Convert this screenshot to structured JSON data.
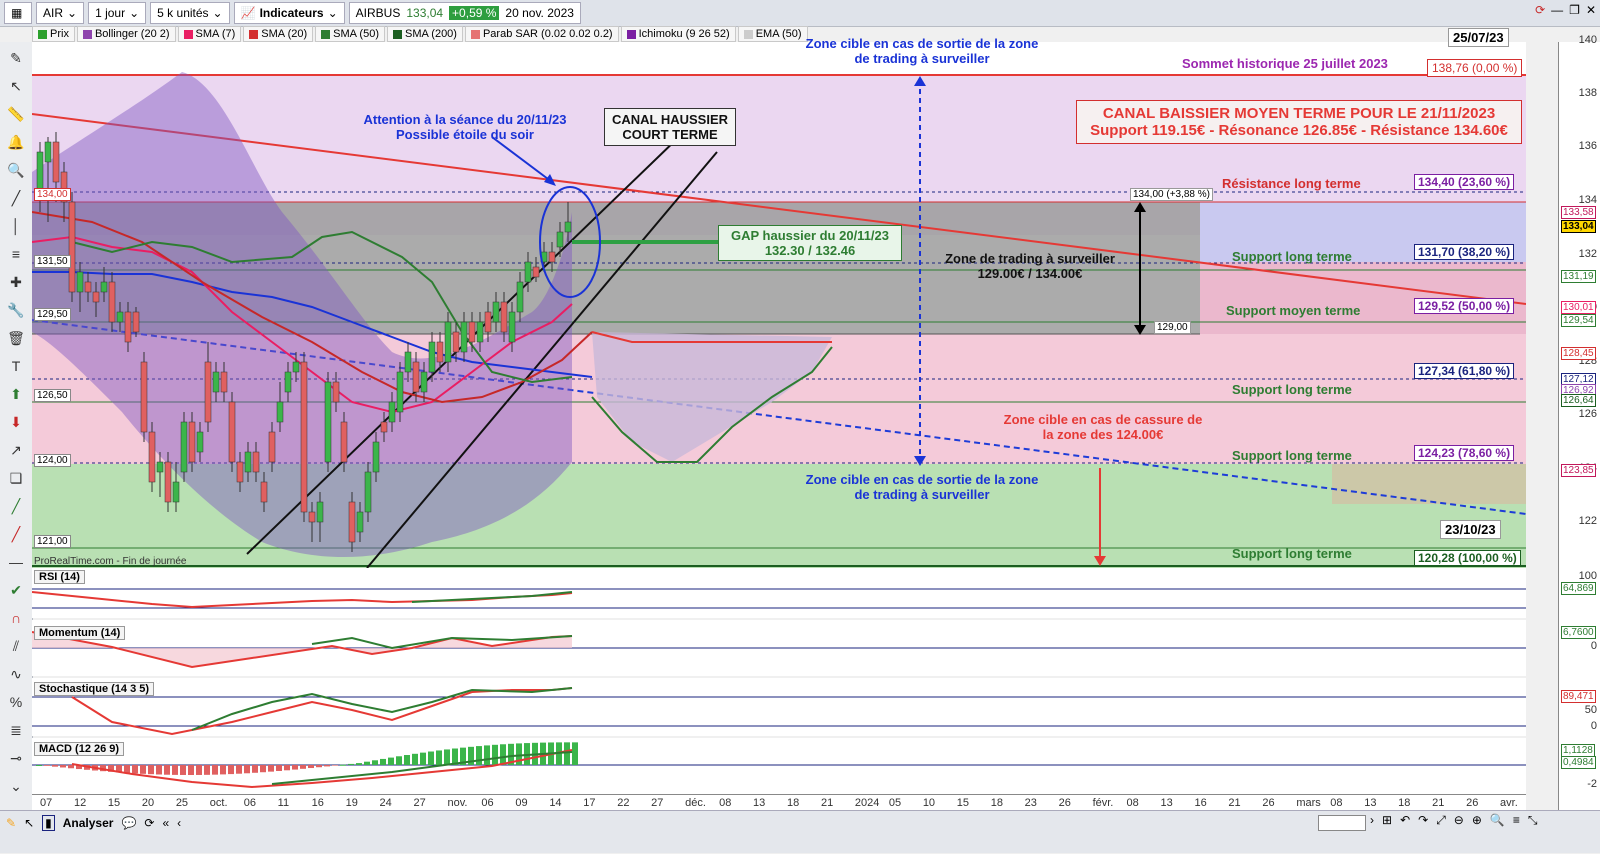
{
  "toolbar": {
    "symbol": "AIR",
    "period": "1 jour",
    "units": "5 k unités",
    "indicators": "Indicateurs",
    "instrument": "AIRBUS",
    "price": "133,04",
    "change": "+0,59 %",
    "date": "20 nov. 2023"
  },
  "legend": [
    {
      "label": "Prix",
      "color": "#2ca02c"
    },
    {
      "label": "Bollinger (20 2)",
      "color": "#8e44ad"
    },
    {
      "label": "SMA (7)",
      "color": "#e91e63"
    },
    {
      "label": "SMA (20)",
      "color": "#d32f2f"
    },
    {
      "label": "SMA (50)",
      "color": "#2e7d32"
    },
    {
      "label": "SMA (200)",
      "color": "#1b5e20"
    },
    {
      "label": "Parab SAR (0.02 0.02 0.2)",
      "color": "#e57373"
    },
    {
      "label": "Ichimoku (9 26 52)",
      "color": "#7b1fa2"
    },
    {
      "label": "EMA (50)",
      "color": "#cccccc"
    }
  ],
  "annotations": {
    "zone_top": "Zone cible en cas de sortie de la zone de trading à surveiller",
    "sommet": "Sommet historique 25 juillet 2023",
    "sommet_date": "25/07/23",
    "sommet_price": "138,76 (0,00 %)",
    "canal_baissier_title": "CANAL BAISSIER MOYEN TERME POUR LE 21/11/2023",
    "canal_baissier_levels": "Support 119.15€ - Résonance 126.85€ - Résistance 134.60€",
    "attention": "Attention à la séance du 20/11/23 Possible étoile du soir",
    "canal_haussier": "CANAL HAUSSIER COURT TERME",
    "gap": "GAP haussier du 20/11/23 132.30 / 132.46",
    "zone_trading": "Zone de trading à surveiller 129.00€ / 134.00€",
    "resistance_lt": "Résistance long terme",
    "support_lt_1": "Support long terme",
    "support_mt": "Support moyen terme",
    "support_lt_2": "Support long terme",
    "support_lt_3": "Support long terme",
    "support_lt_4": "Support long terme",
    "zone_cassure": "Zone cible en cas de cassure de la zone des 124.00€",
    "zone_bottom": "Zone cible en cas de sortie de la zone de trading à surveiller",
    "date_bottom": "23/10/23",
    "box_134": "134,00 (+3,88 %)",
    "box_129": "129,00",
    "footer": "ProRealTime.com - Fin de journée"
  },
  "fib_levels": [
    {
      "label": "134,40 (23,60 %)",
      "color": "#7b1fa2"
    },
    {
      "label": "131,70 (38,20 %)",
      "color": "#1a237e"
    },
    {
      "label": "129,52 (50,00 %)",
      "color": "#7b1fa2"
    },
    {
      "label": "127,34 (61,80 %)",
      "color": "#1a237e"
    },
    {
      "label": "124,23 (78,60 %)",
      "color": "#7b1fa2"
    },
    {
      "label": "120,28 (100,00 %)",
      "color": "#1b5e20"
    }
  ],
  "left_levels": [
    "134,00",
    "131,50",
    "129,50",
    "126,50",
    "124,00",
    "121,00"
  ],
  "right_axis": [
    "140",
    "138",
    "136",
    "134",
    "132",
    "130",
    "128",
    "126",
    "124",
    "122"
  ],
  "right_tags": [
    {
      "label": "133,58",
      "color": "#c2185b"
    },
    {
      "label": "133,04",
      "color": "#000000"
    },
    {
      "label": "131,19",
      "color": "#2e7d32"
    },
    {
      "label": "130,01",
      "color": "#e91e63"
    },
    {
      "label": "129,54",
      "color": "#2e7d32"
    },
    {
      "label": "128,45",
      "color": "#d32f2f"
    },
    {
      "label": "127,12",
      "color": "#1a237e"
    },
    {
      "label": "126,92",
      "color": "#8e44ad"
    },
    {
      "label": "126,64",
      "color": "#1b5e20"
    },
    {
      "label": "123,85",
      "color": "#c2185b"
    }
  ],
  "panels": [
    {
      "name": "RSI (14)",
      "value": "64,869",
      "scale_top": "100",
      "scale_bot": ""
    },
    {
      "name": "Momentum (14)",
      "value": "6,7600",
      "scale_top": "",
      "scale_bot": "0"
    },
    {
      "name": "Stochastique (14 3 5)",
      "value": "89,471",
      "scale_top": "50",
      "scale_bot": "0"
    },
    {
      "name": "MACD (12 26 9)",
      "value": "1,1128",
      "scale_top": "0,4984",
      "scale_bot": "-2"
    }
  ],
  "xaxis": [
    "07",
    "12",
    "15",
    "20",
    "25",
    "oct.",
    "06",
    "11",
    "16",
    "19",
    "24",
    "27",
    "nov.",
    "06",
    "09",
    "14",
    "17",
    "22",
    "27",
    "déc.",
    "08",
    "13",
    "18",
    "21",
    "2024",
    "05",
    "10",
    "15",
    "18",
    "23",
    "26",
    "févr.",
    "08",
    "13",
    "16",
    "21",
    "26",
    "mars",
    "08",
    "13",
    "18",
    "21",
    "26",
    "avr."
  ],
  "bottom": {
    "analyser": "Analyser"
  },
  "chart_data": {
    "type": "candlestick",
    "instrument": "AIRBUS",
    "last_price": 133.04,
    "change_pct": 0.59,
    "ylim": [
      120,
      141
    ],
    "levels": {
      "resistance": 134.0,
      "support": 129.0,
      "gap": [
        132.3,
        132.46
      ],
      "historical_high": 138.76
    }
  }
}
